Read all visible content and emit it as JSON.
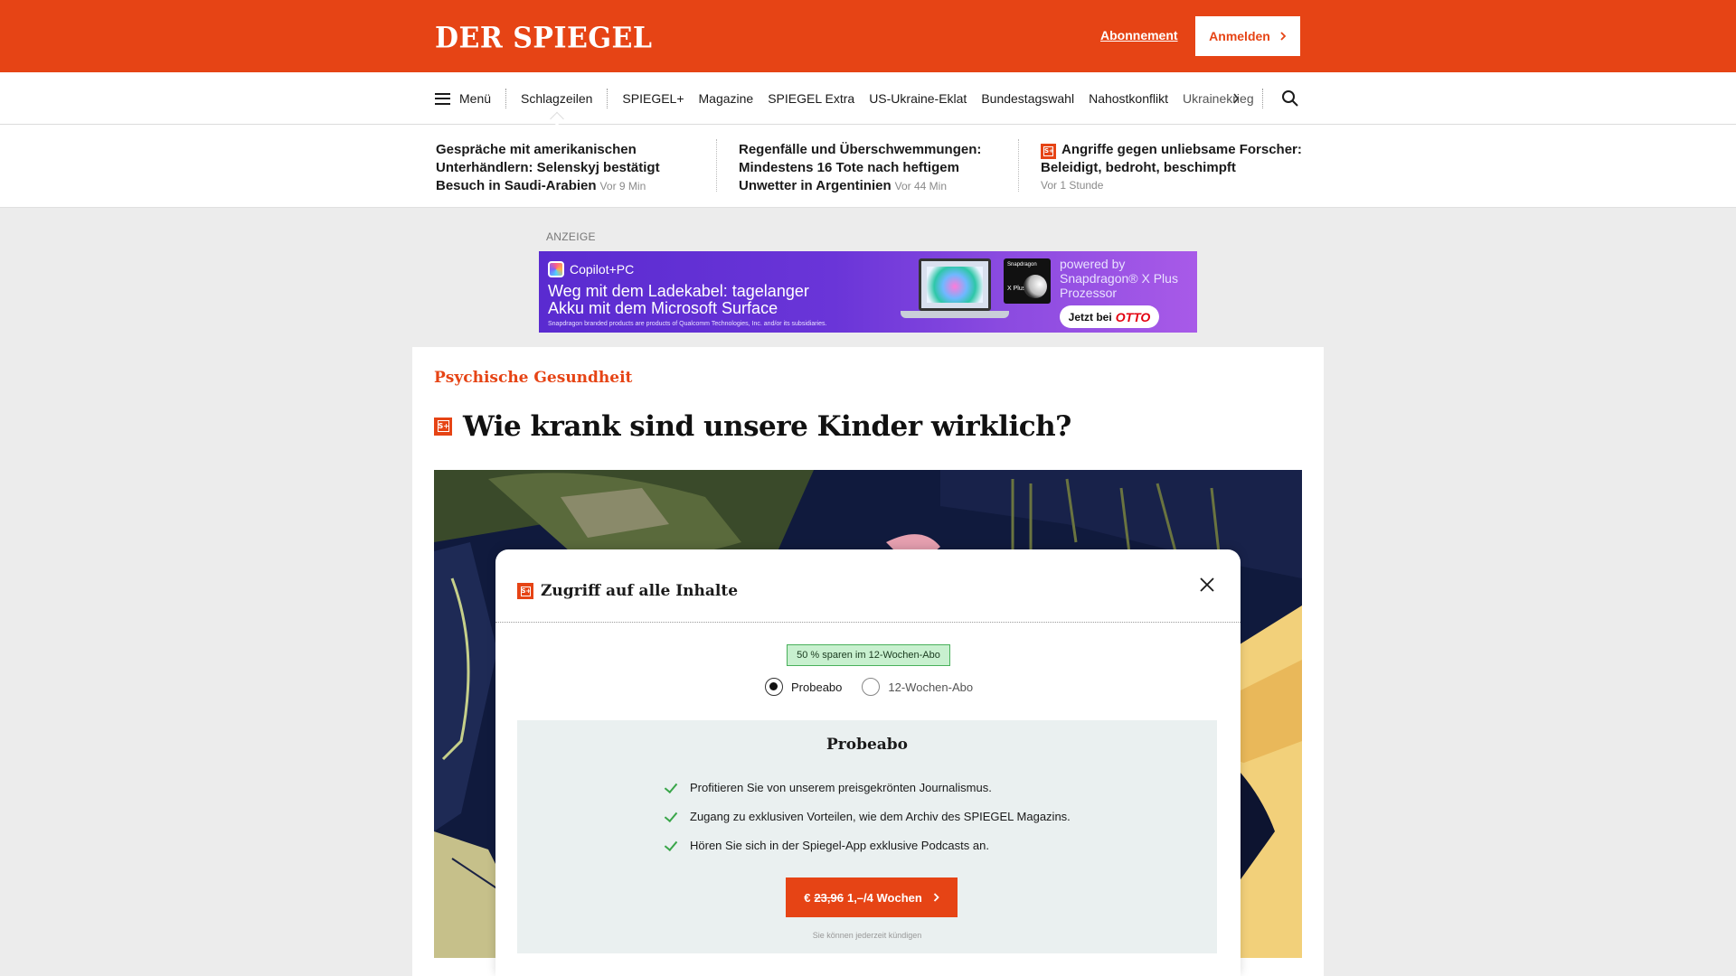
{
  "header": {
    "logo": "DER SPIEGEL",
    "subscription_link": "Abonnement",
    "login_button": "Anmelden",
    "brand_color": "#e64415"
  },
  "nav": {
    "menu_label": "Menü",
    "items": [
      "Schlagzeilen",
      "SPIEGEL+",
      "Magazine",
      "SPIEGEL Extra",
      "US-Ukraine-Eklat",
      "Bundestagswahl",
      "Nahostkonflikt",
      "Ukrainekrieg"
    ],
    "active_item": "Schlagzeilen",
    "next_icon": "chevron-right-icon",
    "search_icon": "search-icon"
  },
  "headlines": [
    {
      "title": "Gespräche mit amerikanischen Unterhändlern: Selenskyj bestätigt Besuch in Saudi-Arabien",
      "time": "Vor 9 Min",
      "plus": false
    },
    {
      "title": "Regenfälle und Überschwemmungen: Mindestens 16 Tote nach heftigem Unwetter in Argentinien",
      "time": "Vor 44 Min",
      "plus": false
    },
    {
      "title": "Angriffe gegen unliebsame Forscher: Beleidigt, bedroht, beschimpft",
      "time": "Vor 1 Stunde",
      "plus": true
    }
  ],
  "ad": {
    "label": "ANZEIGE",
    "brand": "Copilot+PC",
    "headline_line1": "Weg mit dem Ladekabel: tagelanger",
    "headline_line2": "Akku mit dem Microsoft Surface",
    "fine_print": "Snapdragon branded products are products of Qualcomm Technologies, Inc. and/or its subsidiaries.",
    "chip_brand": "Snapdragon",
    "chip_model": "X Plus",
    "powered_line1": "powered by",
    "powered_line2": "Snapdragon® X Plus",
    "powered_line3": "Prozessor",
    "cta_prefix": "Jetzt bei",
    "cta_brand": "OTTO"
  },
  "article": {
    "kicker": "Psychische Gesundheit",
    "title": "Wie krank sind unsere Kinder wirklich?",
    "plus_badge": "S+"
  },
  "modal": {
    "title": "Zugriff auf alle Inhalte",
    "plus_badge": "S+",
    "save_badge": "50 % sparen im 12-Wochen-Abo",
    "options": [
      "Probeabo",
      "12-Wochen-Abo"
    ],
    "selected_option": "Probeabo",
    "offer_title": "Probeabo",
    "benefits": [
      "Profitieren Sie von unserem preisgekrönten Journalismus.",
      "Zugang zu exklusiven Vorteilen, wie dem Archiv des SPIEGEL Magazins.",
      "Hören Sie sich in der Spiegel-App exklusive Podcasts an."
    ],
    "cta_currency": "€",
    "cta_old_price": "23,96",
    "cta_new_price": "1,–/4 Wochen",
    "cancel_note": "Sie können jederzeit kündigen"
  }
}
